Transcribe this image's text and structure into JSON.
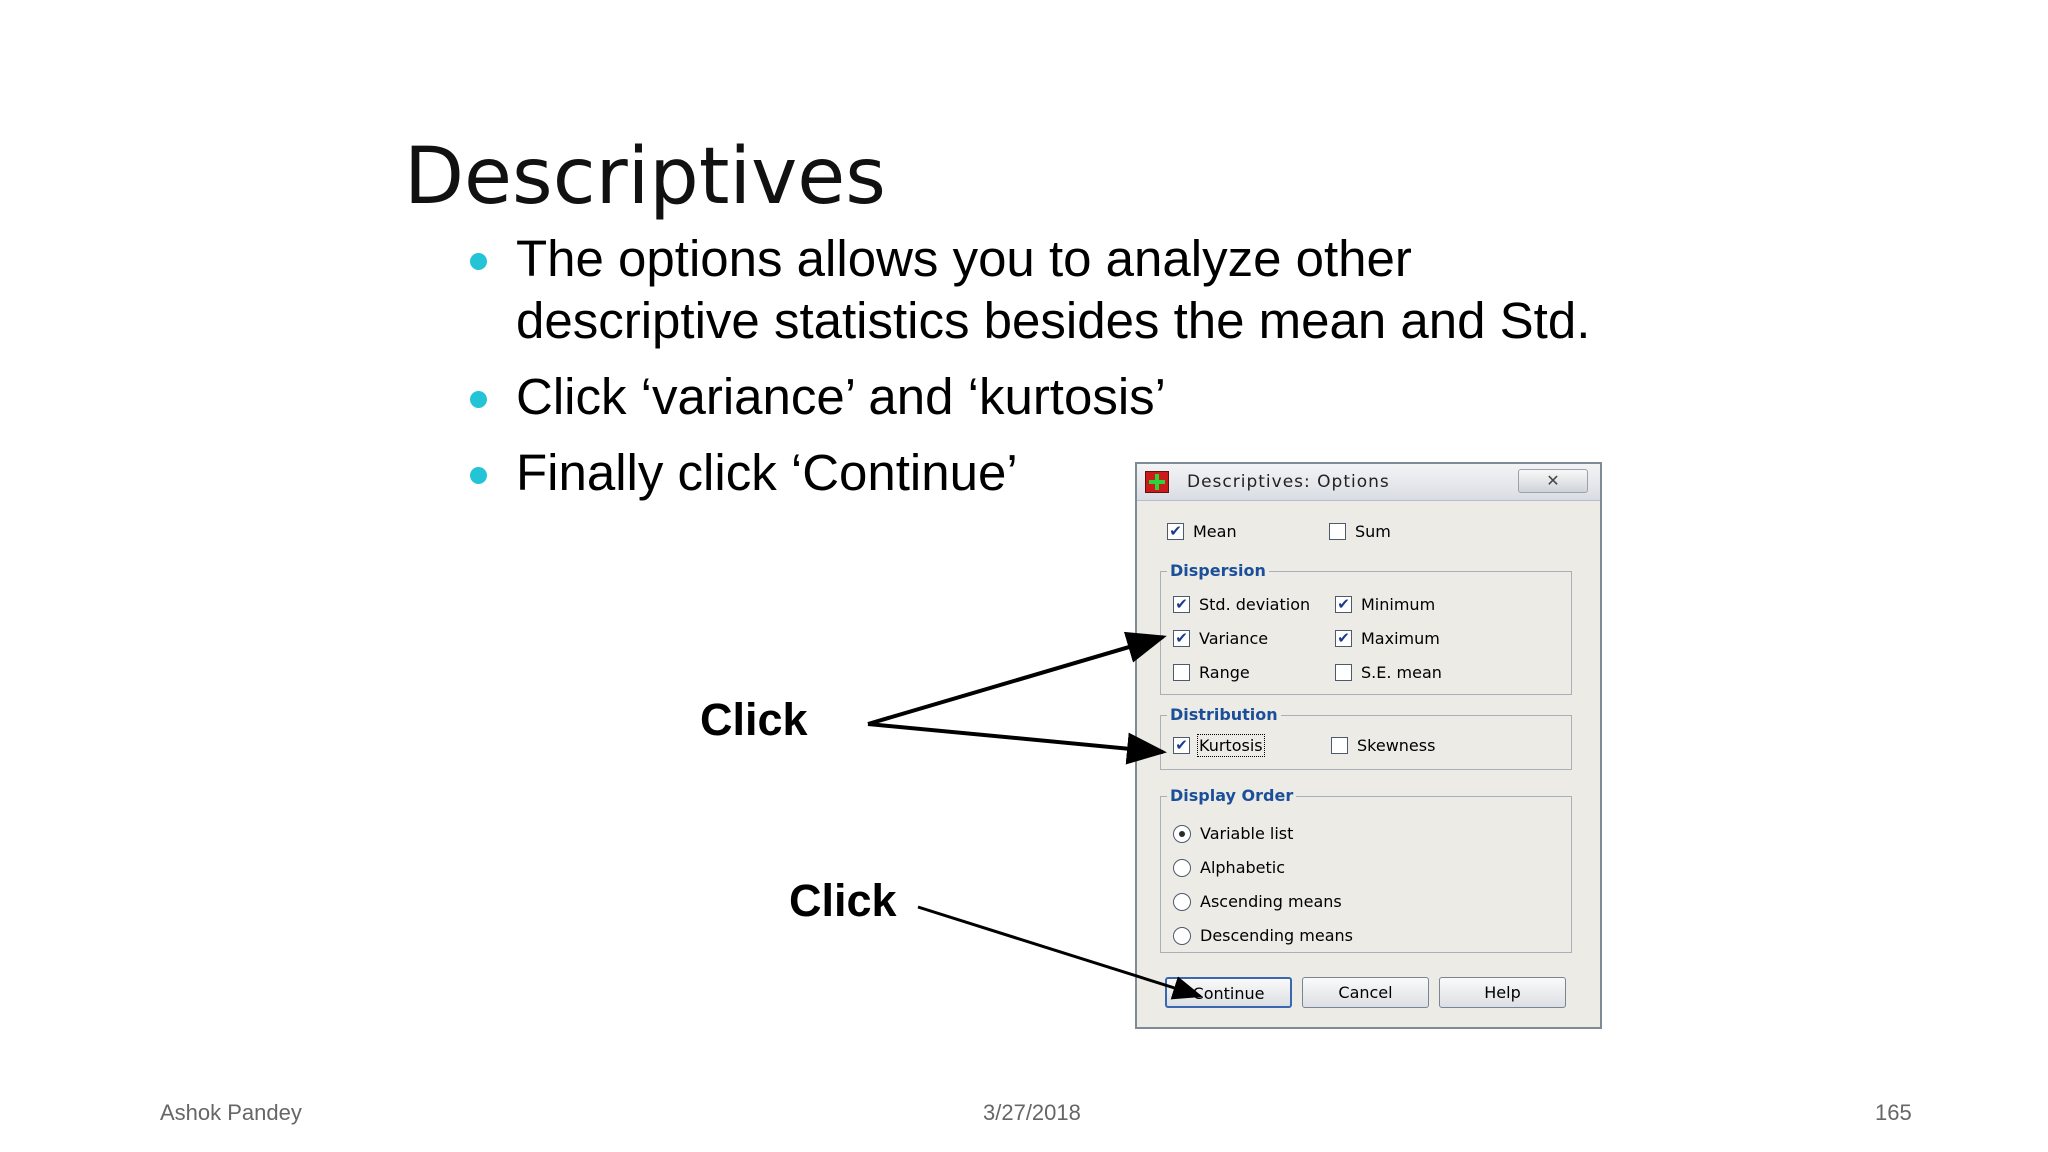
{
  "slide": {
    "title": "Descriptives",
    "bullets": [
      "The options allows you to analyze other descriptive statistics besides the mean and Std.",
      "Click ‘variance’ and ‘kurtosis’",
      "Finally click ‘Continue’"
    ],
    "annotations": [
      "Click",
      "Click"
    ],
    "bullet_color": "#22c4d6"
  },
  "dialog": {
    "title": "Descriptives: Options",
    "icon": "spss-options-icon",
    "close_glyph": "✕",
    "mean": {
      "label": "Mean",
      "checked": true
    },
    "sum": {
      "label": "Sum",
      "checked": false
    },
    "dispersion": {
      "label": "Dispersion",
      "items": [
        {
          "label": "Std. deviation",
          "checked": true
        },
        {
          "label": "Minimum",
          "checked": true
        },
        {
          "label": "Variance",
          "checked": true
        },
        {
          "label": "Maximum",
          "checked": true
        },
        {
          "label": "Range",
          "checked": false
        },
        {
          "label": "S.E. mean",
          "checked": false
        }
      ]
    },
    "distribution": {
      "label": "Distribution",
      "items": [
        {
          "label": "Kurtosis",
          "checked": true
        },
        {
          "label": "Skewness",
          "checked": false
        }
      ]
    },
    "display_order": {
      "label": "Display Order",
      "options": [
        "Variable list",
        "Alphabetic",
        "Ascending means",
        "Descending means"
      ],
      "selected": "Variable list"
    },
    "buttons": {
      "continue": "Continue",
      "cancel": "Cancel",
      "help": "Help"
    },
    "check_glyph": "✔"
  },
  "footer": {
    "author": "Ashok Pandey",
    "date": "3/27/2018",
    "page": "165"
  }
}
